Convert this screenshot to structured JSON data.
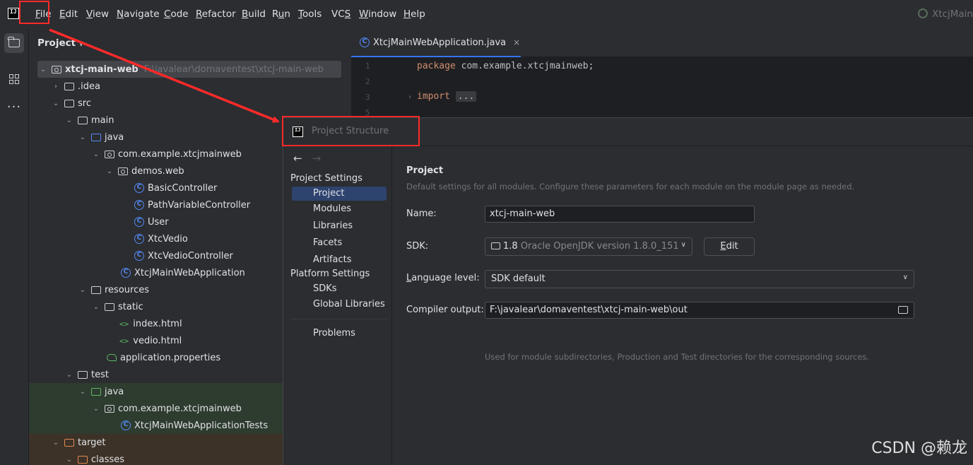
{
  "menubar": {
    "logo": "IJ",
    "items": [
      {
        "pre": "",
        "ul": "F",
        "post": "ile"
      },
      {
        "pre": "",
        "ul": "E",
        "post": "dit"
      },
      {
        "pre": "",
        "ul": "V",
        "post": "iew"
      },
      {
        "pre": "",
        "ul": "N",
        "post": "avigate"
      },
      {
        "pre": "",
        "ul": "C",
        "post": "ode"
      },
      {
        "pre": "",
        "ul": "R",
        "post": "efactor"
      },
      {
        "pre": "",
        "ul": "B",
        "post": "uild"
      },
      {
        "pre": "R",
        "ul": "u",
        "post": "n"
      },
      {
        "pre": "",
        "ul": "T",
        "post": "ools"
      },
      {
        "pre": "VC",
        "ul": "S",
        "post": ""
      },
      {
        "pre": "",
        "ul": "W",
        "post": "indow"
      },
      {
        "pre": "",
        "ul": "H",
        "post": "elp"
      }
    ],
    "window_title": "XtcjMain"
  },
  "project_panel": {
    "header": "Project",
    "chevron": "∨",
    "root_name": "xtcj-main-web",
    "root_path": "F:\\javalear\\domaventest\\xtcj-main-web",
    "nodes": {
      "idea": ".idea",
      "src": "src",
      "main": "main",
      "java": "java",
      "pkg": "com.example.xtcjmainweb",
      "demos": "demos.web",
      "basic": "BasicController",
      "pathvar": "PathVariableController",
      "user": "User",
      "vedio": "XtcVedio",
      "vedioctl": "XtcVedioController",
      "app": "XtcjMainWebApplication",
      "resources": "resources",
      "static": "static",
      "index": "index.html",
      "vediohtml": "vedio.html",
      "props": "application.properties",
      "test": "test",
      "testjava": "java",
      "testpkg": "com.example.xtcjmainweb",
      "apptests": "XtcjMainWebApplicationTests",
      "target": "target",
      "classes": "classes"
    }
  },
  "editor": {
    "tab": "XtcjMainWebApplication.java",
    "close": "×",
    "lines": [
      "1",
      "2",
      "3",
      "5"
    ],
    "kw_package": "package",
    "package_name": " com.example.xtcjmainweb;",
    "kw_import": "import",
    "import_fold": "..."
  },
  "dialog": {
    "logo": "IJ",
    "title": "Project Structure",
    "nav_back": "←",
    "nav_fwd": "→",
    "section_project_settings": "Project Settings",
    "nav_project": "Project",
    "nav_modules": "Modules",
    "nav_libraries": "Libraries",
    "nav_facets": "Facets",
    "nav_artifacts": "Artifacts",
    "section_platform_settings": "Platform Settings",
    "nav_sdks": "SDKs",
    "nav_global_libraries": "Global Libraries",
    "nav_problems": "Problems",
    "content": {
      "title": "Project",
      "description": "Default settings for all modules. Configure these parameters for each module on the module page as needed.",
      "name_label": "Name:",
      "name_value": "xtcj-main-web",
      "sdk_label": "SDK:",
      "sdk_version": "1.8",
      "sdk_detail": " Oracle OpenJDK version 1.8.0_151",
      "edit_ul": "E",
      "edit_rest": "dit",
      "lang_label_ul": "L",
      "lang_label_rest": "anguage level:",
      "lang_value": "SDK default",
      "compiler_label": "Compiler output:",
      "compiler_value": "F:\\javalear\\domaventest\\xtcj-main-web\\out",
      "compiler_hint": "Used for module subdirectories, Production and Test directories for the corresponding sources."
    }
  },
  "watermark": "CSDN @赖龙",
  "colors": {
    "annotation": "#ff2a2a",
    "accent": "#3574f0"
  }
}
